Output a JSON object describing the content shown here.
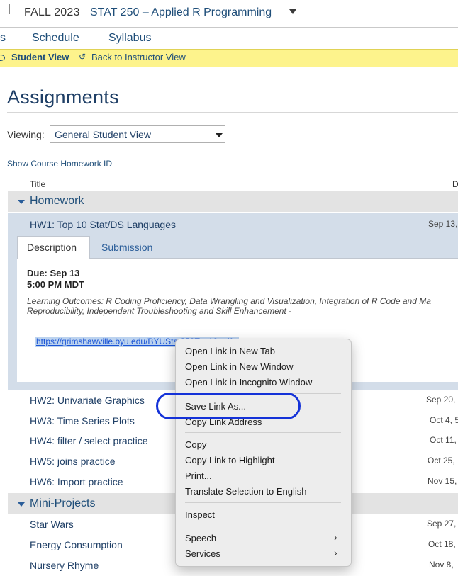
{
  "header": {
    "term": "FALL 2023",
    "course": "STAT 250 – Applied R Programming"
  },
  "nav": {
    "partial": "s",
    "items": [
      "Schedule",
      "Syllabus"
    ]
  },
  "student_view_bar": {
    "student_view": "Student View",
    "back": "Back to Instructor View"
  },
  "page": {
    "title": "Assignments",
    "viewing_label": "Viewing:",
    "viewing_value": "General Student View",
    "show_id": "Show Course Homework ID"
  },
  "table": {
    "col_title": "Title",
    "col_date_partial": "D",
    "groups": [
      {
        "label": "Homework",
        "items": [
          {
            "title": "HW1: Top 10 Stat/DS Languages",
            "date": "Sep 13,"
          },
          {
            "title": "HW2: Univariate Graphics",
            "date": "Sep 20,"
          },
          {
            "title": "HW3: Time Series Plots",
            "date": "Oct 4, 5"
          },
          {
            "title": "HW4: filter / select practice",
            "date": "Oct 11, 5"
          },
          {
            "title": "HW5: joins practice",
            "date": "Oct 25,"
          },
          {
            "title": "HW6: Import practice",
            "date": "Nov 15,"
          }
        ]
      },
      {
        "label": "Mini-Projects",
        "items": [
          {
            "title": "Star Wars",
            "date": "Sep 27,"
          },
          {
            "title": "Energy Consumption",
            "date": "Oct 18,"
          },
          {
            "title": "Nursery Rhyme",
            "date": "Nov 8,"
          }
        ]
      }
    ]
  },
  "hw1_detail": {
    "tabs": [
      "Description",
      "Submission"
    ],
    "due_date": "Due: Sep 13",
    "due_time": "5:00 PM MDT",
    "outcomes": "Learning Outcomes: R Coding Proficiency, Data Wrangling and Visualization, Integration of R Code and Ma Reproducibility, Independent Troubleshooting and Skill Enhancement -",
    "link_text": "https://grimshawville.byu.edu/BYUStat250Top10.pdf"
  },
  "context_menu": {
    "items": [
      "Open Link in New Tab",
      "Open Link in New Window",
      "Open Link in Incognito Window",
      "Save Link As...",
      "Copy Link Address",
      "Copy",
      "Copy Link to Highlight",
      "Print...",
      "Translate Selection to English",
      "Inspect",
      "Speech",
      "Services"
    ]
  },
  "colors": {
    "accent": "#1f4e79",
    "banner": "#fdf38c",
    "callout": "#1432d8"
  }
}
